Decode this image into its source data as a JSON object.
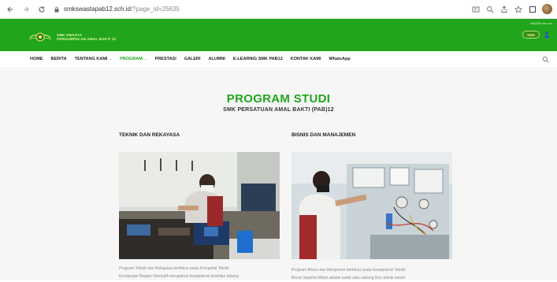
{
  "browser": {
    "url_host": "smkswastapab12.sch.id",
    "url_path": "/?page_id=25635",
    "icons": [
      "back-arrow",
      "forward-arrow",
      "reload",
      "lock",
      "extension",
      "zoom",
      "share",
      "bookmark-star",
      "tab-search",
      "profile-avatar"
    ]
  },
  "header": {
    "logo_line1": "SMK SWASTA",
    "logo_line2": "PERKUMPULAN AMAL BAKTI 12",
    "note": "081234 xxx xxx",
    "badge_label": "SMK",
    "accent_color": "#21a51d"
  },
  "menu": {
    "items": [
      {
        "label": "HOME",
        "dropdown": false,
        "active": false
      },
      {
        "label": "BERITA",
        "dropdown": false,
        "active": false
      },
      {
        "label": "TENTANG KAMI",
        "dropdown": true,
        "active": false
      },
      {
        "label": "PROGRAM",
        "dropdown": true,
        "active": true
      },
      {
        "label": "PRESTASI",
        "dropdown": false,
        "active": false
      },
      {
        "label": "GALERI",
        "dropdown": false,
        "active": false
      },
      {
        "label": "ALUMNI",
        "dropdown": false,
        "active": false
      },
      {
        "label": "E-LEARNIG SMK PAB12",
        "dropdown": false,
        "active": false
      },
      {
        "label": "KONTAK KAMI",
        "dropdown": false,
        "active": false
      },
      {
        "label": "WhatsApp",
        "dropdown": false,
        "active": false
      }
    ],
    "caret": "⌄"
  },
  "page": {
    "title": "PROGRAM STUDI",
    "subtitle": "SMK PERSATUAN AMAL BAKTI (PAB)12"
  },
  "programs": [
    {
      "title": "TEKNIK DAN REKAYASA",
      "text_line1": "Program Teknik dan Rekayasa berfokus pada Kompetisi Teknik",
      "text_line2": "Kendaraan Ringan Otomotif merupakan kompetensi keahlian bidang"
    },
    {
      "title": "BISNIS DAN MANAJEMEN",
      "text_line1": "Program Bisnis dan Manjemen berfokus pada Kompetensi Teknik",
      "text_line2": "Bisnis Sepeda Motor adalah salah satu cabang ilmu teknik mesin"
    }
  ]
}
